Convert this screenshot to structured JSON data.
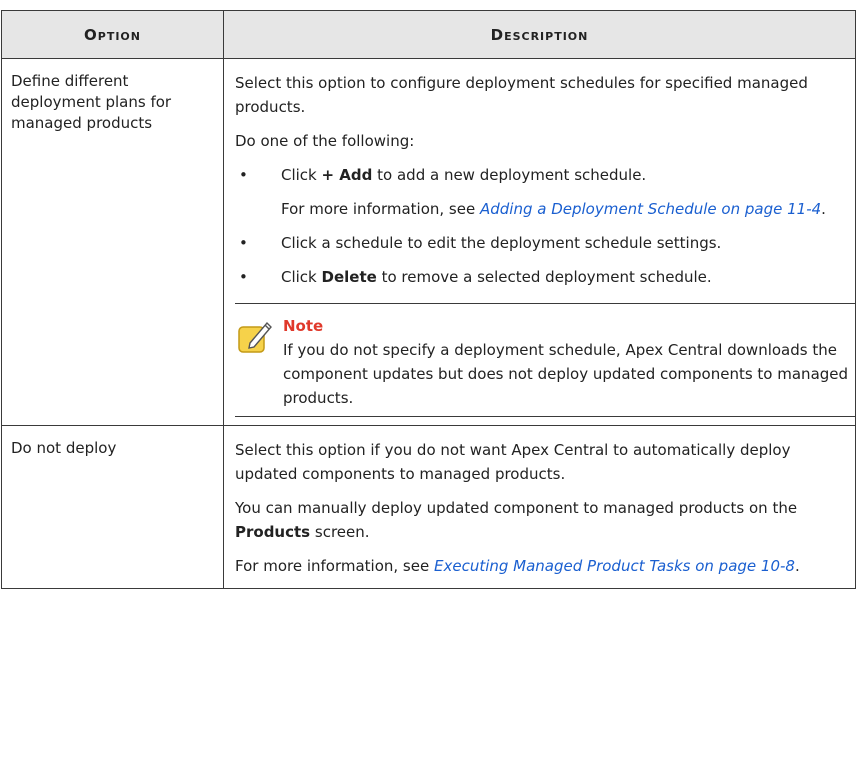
{
  "header": {
    "option": "Option",
    "description": "Description"
  },
  "row1": {
    "option": "Define different deployment plans for managed products",
    "intro": "Select this option to configure deployment schedules for specified managed products.",
    "lead": "Do one of the following:",
    "b1_pre": "Click ",
    "b1_bold": "+ Add",
    "b1_post": " to add a new deployment schedule.",
    "b1_more_pre": "For more information, see ",
    "b1_link": "Adding a Deployment Schedule on page 11-4",
    "b1_more_post": ".",
    "b2": "Click a schedule to edit the deployment schedule settings.",
    "b3_pre": "Click ",
    "b3_bold": "Delete",
    "b3_post": " to remove a selected deployment schedule.",
    "note_title": "Note",
    "note_body": "If you do not specify a deployment schedule, Apex Central downloads the component updates but does not deploy updated components to managed products.",
    "bullet": "•"
  },
  "row2": {
    "option": "Do not deploy",
    "p1": "Select this option if you do not want Apex Central to automatically deploy updated components to managed products.",
    "p2_pre": "You can manually deploy updated component to managed products on the ",
    "p2_bold": "Products",
    "p2_post": " screen.",
    "p3_pre": "For more information, see ",
    "p3_link": "Executing Managed Product Tasks on page 10-8",
    "p3_post": "."
  },
  "colors": {
    "header_bg": "#e6e6e6",
    "link": "#1a5fd0",
    "note_title": "#e0392b",
    "note_icon": "#f2c230"
  },
  "icons": {
    "note": "pencil-note-icon"
  }
}
